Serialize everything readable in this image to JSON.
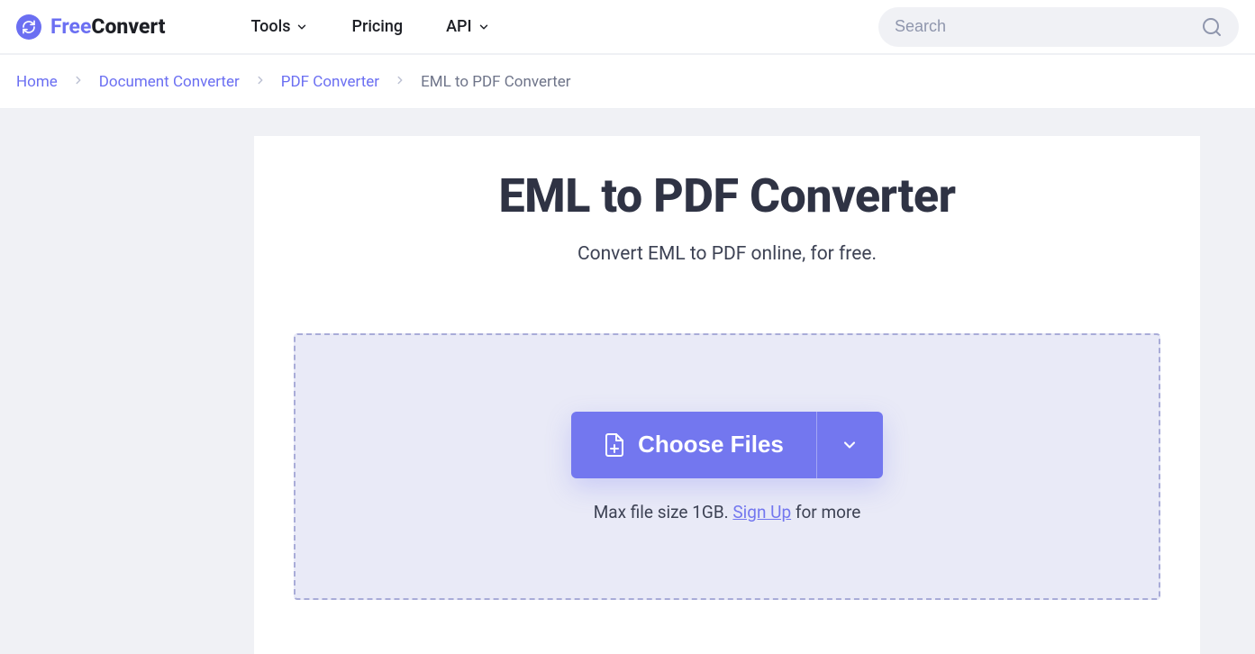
{
  "brand": {
    "part1": "Free",
    "part2": "Convert"
  },
  "nav": {
    "tools": "Tools",
    "pricing": "Pricing",
    "api": "API"
  },
  "search": {
    "placeholder": "Search"
  },
  "breadcrumb": {
    "home": "Home",
    "doc": "Document Converter",
    "pdf": "PDF Converter",
    "current": "EML to PDF Converter"
  },
  "page": {
    "title": "EML to PDF Converter",
    "subtitle": "Convert EML to PDF online, for free.",
    "choose_label": "Choose Files",
    "size_pre": "Max file size 1GB. ",
    "signup": "Sign Up",
    "size_post": " for more"
  }
}
